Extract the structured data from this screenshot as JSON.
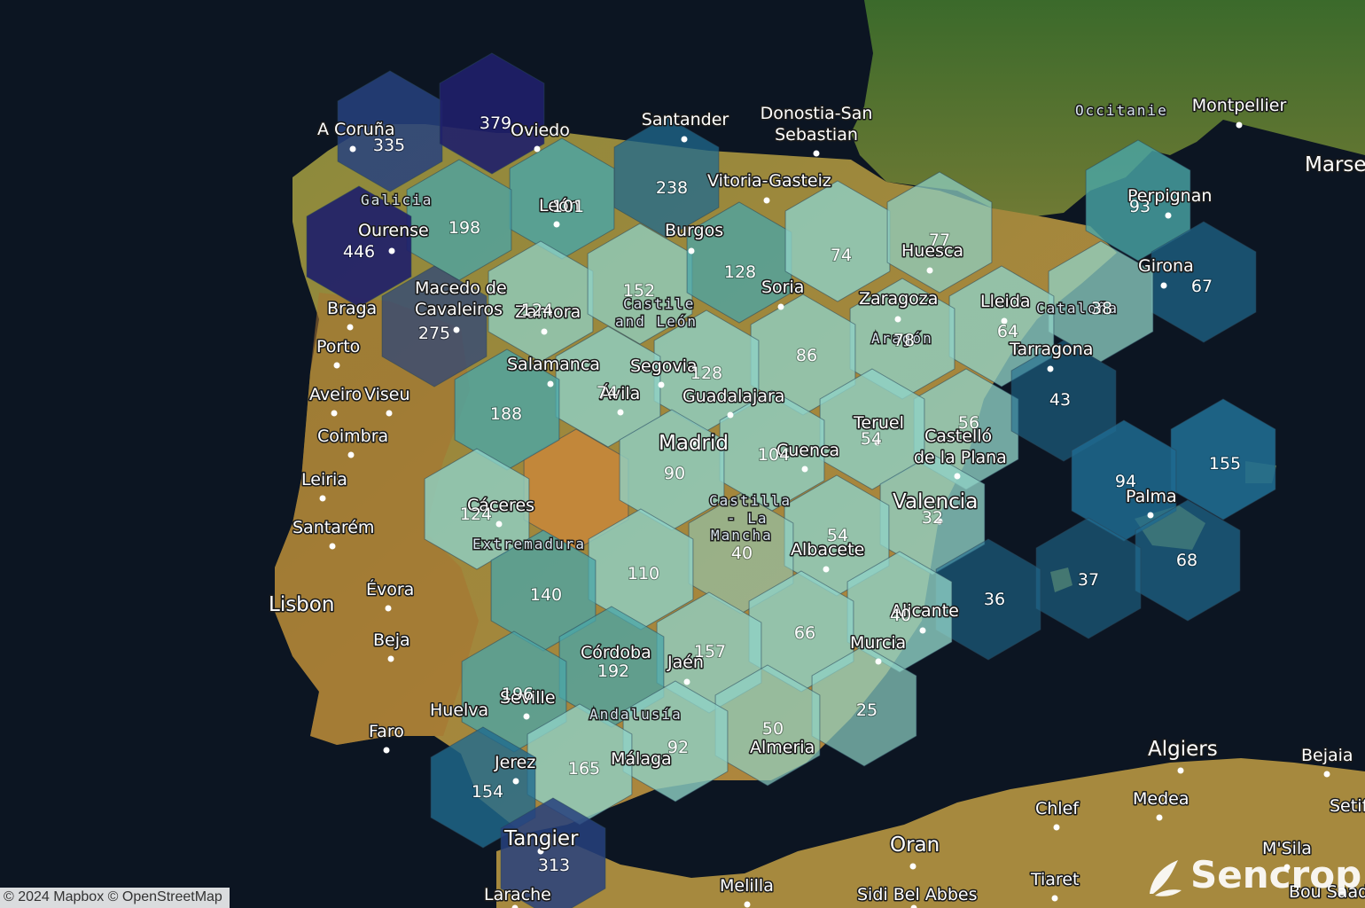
{
  "map": {
    "colors": {
      "ocean": "#0b1420",
      "land_north": "#3d6b2a",
      "land_south": "#b98a3c",
      "land_africa": "#a98b3f",
      "hex_light": "#8fd1c5",
      "hex_mid": "#4aa6a8",
      "hex_dark": "#1f6a8f",
      "hex_darker": "#27417e",
      "hex_darkest": "#1f1f6a",
      "hex_empty": "#c8873a"
    },
    "counts": [
      {
        "value": "335"
      },
      {
        "value": "379"
      },
      {
        "value": "238"
      },
      {
        "value": "101"
      },
      {
        "value": "198"
      },
      {
        "value": "446"
      },
      {
        "value": "275"
      },
      {
        "value": "124"
      },
      {
        "value": "152"
      },
      {
        "value": "128"
      },
      {
        "value": "74"
      },
      {
        "value": "77"
      },
      {
        "value": "93"
      },
      {
        "value": "67"
      },
      {
        "value": "38"
      },
      {
        "value": "64"
      },
      {
        "value": "78"
      },
      {
        "value": "86"
      },
      {
        "value": "128"
      },
      {
        "value": "74"
      },
      {
        "value": "188"
      },
      {
        "value": "56"
      },
      {
        "value": "54"
      },
      {
        "value": "104"
      },
      {
        "value": "90"
      },
      {
        "value": "43"
      },
      {
        "value": "155"
      },
      {
        "value": "94"
      },
      {
        "value": "124"
      },
      {
        "value": "32"
      },
      {
        "value": "54"
      },
      {
        "value": "40"
      },
      {
        "value": "68"
      },
      {
        "value": "37"
      },
      {
        "value": "110"
      },
      {
        "value": "140"
      },
      {
        "value": "36"
      },
      {
        "value": "40"
      },
      {
        "value": "66"
      },
      {
        "value": "157"
      },
      {
        "value": "192"
      },
      {
        "value": "196"
      },
      {
        "value": "25"
      },
      {
        "value": "50"
      },
      {
        "value": "92"
      },
      {
        "value": "165"
      },
      {
        "value": "154"
      },
      {
        "value": "313"
      }
    ],
    "cities": [
      {
        "name": "A Coruña"
      },
      {
        "name": "Oviedo"
      },
      {
        "name": "Santander"
      },
      {
        "name": "Donostia-San"
      },
      {
        "name": "Sebastian"
      },
      {
        "name": "Vitoria-Gasteiz"
      },
      {
        "name": "Montpellier"
      },
      {
        "name": "Marse"
      },
      {
        "name": "Perpignan"
      },
      {
        "name": "Girona"
      },
      {
        "name": "León"
      },
      {
        "name": "Ourense"
      },
      {
        "name": "Burgos"
      },
      {
        "name": "Huesca"
      },
      {
        "name": "Soria"
      },
      {
        "name": "Zaragoza"
      },
      {
        "name": "Lleida"
      },
      {
        "name": "Tarragona"
      },
      {
        "name": "Macedo de"
      },
      {
        "name": "Cavaleiros"
      },
      {
        "name": "Zamora"
      },
      {
        "name": "Braga"
      },
      {
        "name": "Porto"
      },
      {
        "name": "Salamanca"
      },
      {
        "name": "Segovia"
      },
      {
        "name": "Guadalajara"
      },
      {
        "name": "Aveiro"
      },
      {
        "name": "Viseu"
      },
      {
        "name": "Ávila"
      },
      {
        "name": "Coimbra"
      },
      {
        "name": "Madrid"
      },
      {
        "name": "Teruel"
      },
      {
        "name": "Castelló"
      },
      {
        "name": "de la Plana"
      },
      {
        "name": "Cuenca"
      },
      {
        "name": "Leiria"
      },
      {
        "name": "Valencia"
      },
      {
        "name": "Cáceres"
      },
      {
        "name": "Santarém"
      },
      {
        "name": "Albacete"
      },
      {
        "name": "Palma"
      },
      {
        "name": "Lisbon"
      },
      {
        "name": "Évora"
      },
      {
        "name": "Alicante"
      },
      {
        "name": "Beja"
      },
      {
        "name": "Murcia"
      },
      {
        "name": "Córdoba"
      },
      {
        "name": "Jaén"
      },
      {
        "name": "Huelva"
      },
      {
        "name": "Seville"
      },
      {
        "name": "Faro"
      },
      {
        "name": "Almeria"
      },
      {
        "name": "Málaga"
      },
      {
        "name": "Jerez"
      },
      {
        "name": "Algiers"
      },
      {
        "name": "Bejaia"
      },
      {
        "name": "Medea"
      },
      {
        "name": "Chlef"
      },
      {
        "name": "Setif"
      },
      {
        "name": "Oran"
      },
      {
        "name": "M'Sila"
      },
      {
        "name": "Tiaret"
      },
      {
        "name": "Bou Saada"
      },
      {
        "name": "Sidi Bel Abbes"
      },
      {
        "name": "Melilla"
      },
      {
        "name": "Tangier"
      },
      {
        "name": "Larache"
      }
    ],
    "regions": [
      {
        "name": "Occitanie"
      },
      {
        "name": "Galicia"
      },
      {
        "name": "Castile"
      },
      {
        "name": "and León"
      },
      {
        "name": "Cataloña"
      },
      {
        "name": "Aragón"
      },
      {
        "name": "Castilla"
      },
      {
        "name": "- La"
      },
      {
        "name": "Mancha"
      },
      {
        "name": "Extremadura"
      },
      {
        "name": "Andalusía"
      }
    ]
  },
  "attribution": "© 2024 Mapbox © OpenStreetMap",
  "brand": "Sencrop"
}
